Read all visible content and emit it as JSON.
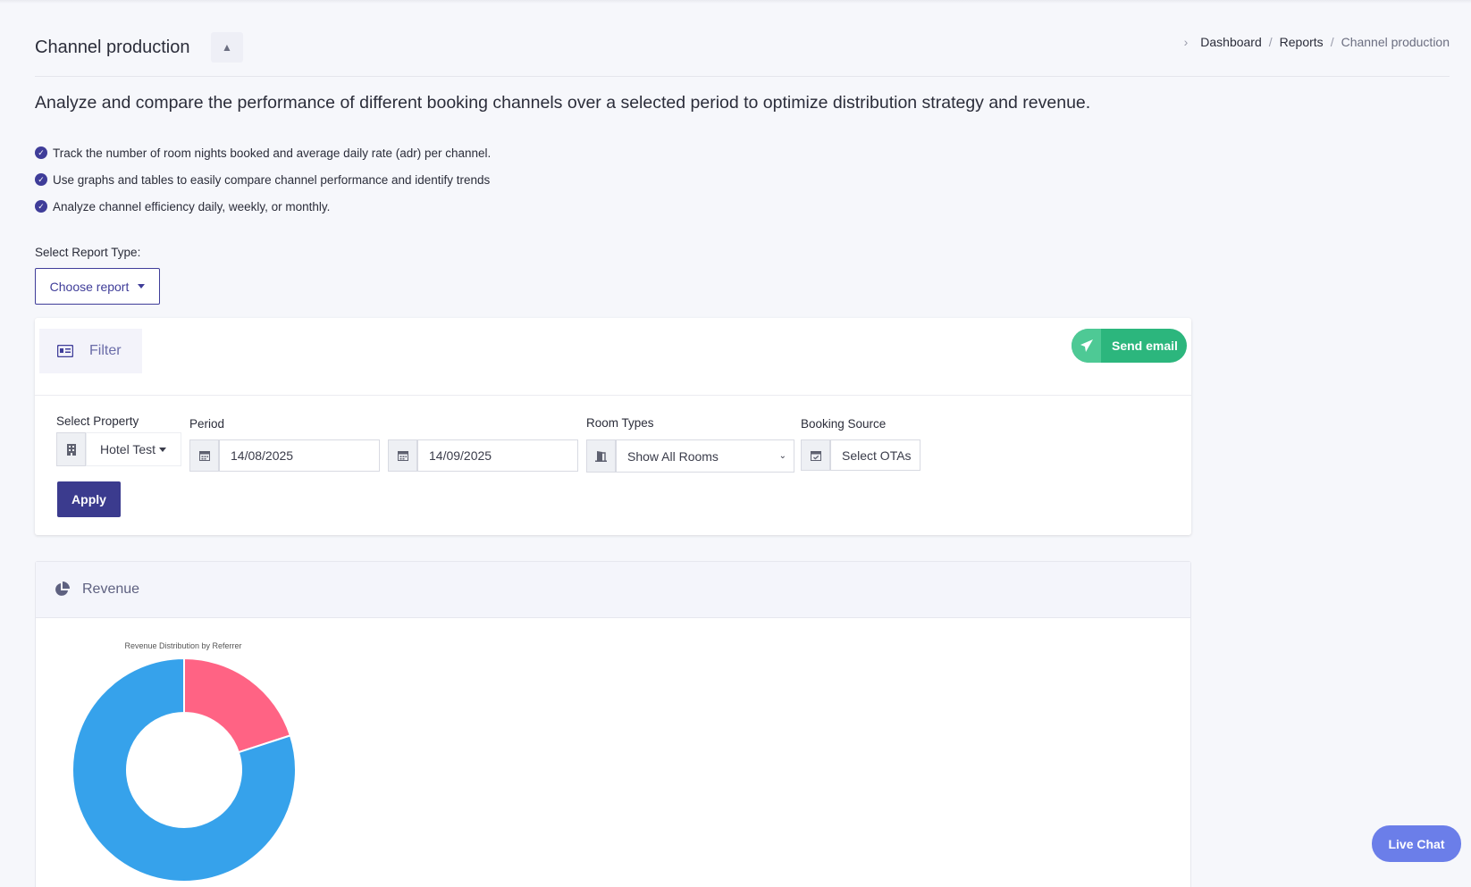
{
  "header": {
    "title": "Channel production",
    "collapse_icon": "▲",
    "breadcrumb": [
      "Dashboard",
      "Reports",
      "Channel production"
    ]
  },
  "intro": "Analyze and compare the performance of different booking channels over a selected period to optimize distribution strategy and revenue.",
  "bullets": [
    "Track the number of room nights booked and average daily rate (adr) per channel.",
    "Use graphs and tables to easily compare channel performance and identify trends",
    "Analyze channel efficiency daily, weekly, or monthly."
  ],
  "report": {
    "label": "Select Report Type:",
    "button": "Choose report"
  },
  "filter": {
    "tab_label": "Filter",
    "send_email": "Send email",
    "property_label": "Select Property",
    "property_value": "Hotel Test",
    "period_label": "Period",
    "period_from": "14/08/2025",
    "period_to": "14/09/2025",
    "room_types_label": "Room Types",
    "room_types_value": "Show All Rooms",
    "booking_source_label": "Booking Source",
    "booking_source_value": "Select OTAs",
    "apply": "Apply"
  },
  "revenue": {
    "title": "Revenue"
  },
  "chart_data": {
    "type": "pie",
    "title": "Revenue Distribution by Referrer",
    "donut": true,
    "slices": [
      {
        "value": 20,
        "color": "#ff6384"
      },
      {
        "value": 80,
        "color": "#36a2eb"
      }
    ]
  },
  "live_chat": "Live Chat",
  "colors": {
    "primary": "#3f3d99",
    "success": "#2cb67d",
    "chat": "#6b7ee9"
  }
}
